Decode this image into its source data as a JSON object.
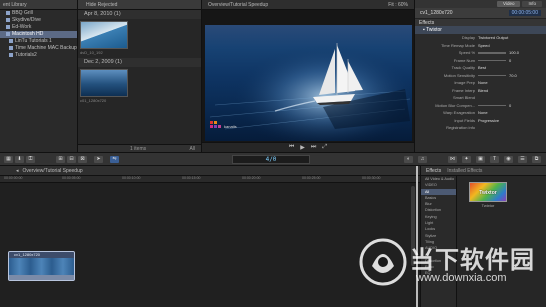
{
  "library": {
    "title": "ent Library",
    "items": [
      {
        "label": "BBQ Grill",
        "selected": false
      },
      {
        "label": "Skydive/Dive",
        "selected": false
      },
      {
        "label": "Ed-Work",
        "selected": false
      },
      {
        "label": "Macintosh HD",
        "selected": true
      },
      {
        "label": "LinTu Tutorials 1",
        "selected": false
      },
      {
        "label": "Time Machine MAC Backup",
        "selected": false
      },
      {
        "label": "Tutorials2",
        "selected": false
      }
    ]
  },
  "browser": {
    "title": "Hide Rejected",
    "groups": [
      {
        "date": "Apr 8, 2010  (1)",
        "clip": "dvD_10_192"
      },
      {
        "date": "Dec 2, 2009  (1)",
        "clip": "c01_1280x720"
      }
    ],
    "footer": "1 items",
    "filter": "All"
  },
  "viewer": {
    "title": "Overview/Tutorial Speedup",
    "zoom": "Fit : 60%",
    "logo_text": "kanatis"
  },
  "inspector": {
    "tabs": [
      "Video",
      "Info"
    ],
    "clip_name": "cv1_1280x720",
    "timecode": "00:00:05:00",
    "section": "Effects",
    "effect_name": "Twixtor",
    "params": [
      {
        "name": "Display",
        "value": "Twixtored Output"
      },
      {
        "name": "Time Remap Mode",
        "value": "Speed"
      },
      {
        "name": "Speed %",
        "value": "100.0"
      },
      {
        "name": "Frame Num",
        "value": "0"
      },
      {
        "name": "Track Quality",
        "value": "Best"
      },
      {
        "name": "Motion Sensitivity",
        "value": "70.0"
      },
      {
        "name": "Image Prep",
        "value": "None"
      },
      {
        "name": "Frame Interp",
        "value": "Blend"
      },
      {
        "name": "Smart Blend",
        "value": ""
      },
      {
        "name": "Motion Blur Compen...",
        "value": "0"
      },
      {
        "name": "Warp Exageration",
        "value": "None"
      },
      {
        "name": "Input Fields",
        "value": "Progressive"
      },
      {
        "name": "Registration info",
        "value": ""
      }
    ]
  },
  "toolbar": {
    "timecode": "4/0"
  },
  "timeline": {
    "title": "Overview/Tutorial Speedup",
    "clip_label": "cv1_1280x720",
    "ruler": [
      "00:00:00:00",
      "00:00:05:00",
      "00:00:10:00",
      "00:00:15:00",
      "00:00:20:00",
      "00:00:25:00",
      "00:00:30:00"
    ]
  },
  "effects": {
    "title": "Effects",
    "filter": "Installed Effects",
    "categories": [
      "All Video & Audio",
      "VIDEO",
      "All",
      "Basics",
      "Blur",
      "Distortion",
      "Keying",
      "Light",
      "Looks",
      "Stylize",
      "Tiling",
      "AUDIO",
      "All",
      "Distortion",
      "Echo",
      "EQ"
    ],
    "selected_category": "All",
    "thumb_text": "Twixtor",
    "thumb_label": "Twixtor"
  },
  "watermark": {
    "cn": "当下软件园",
    "url": "www.downxia.com"
  }
}
